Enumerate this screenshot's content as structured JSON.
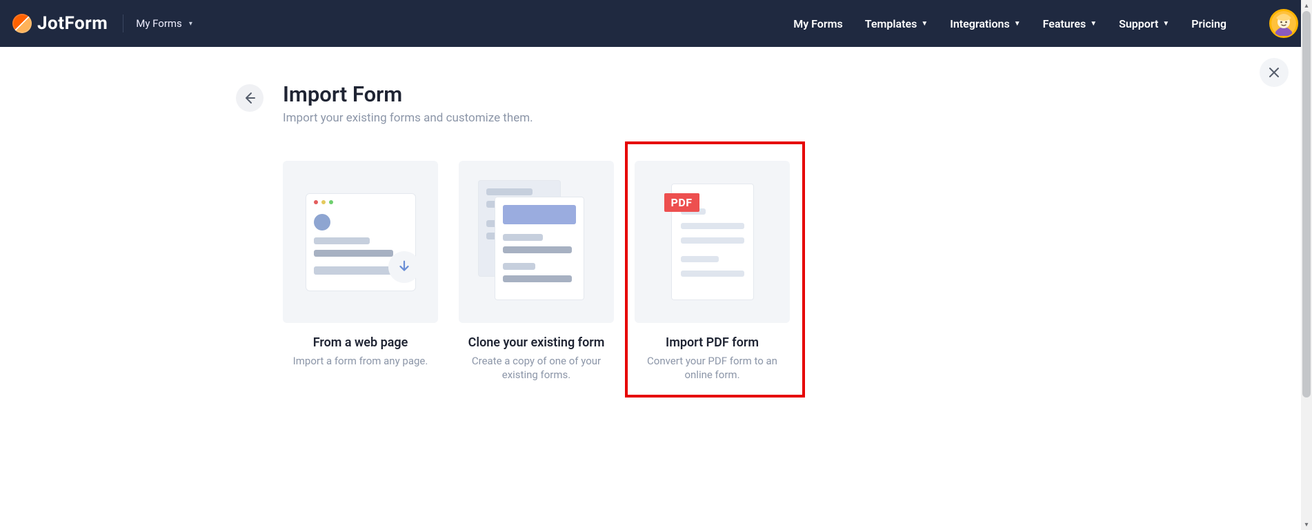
{
  "header": {
    "logo_text": "JotForm",
    "current_area": "My Forms",
    "nav": {
      "my_forms": "My Forms",
      "templates": "Templates",
      "integrations": "Integrations",
      "features": "Features",
      "support": "Support",
      "pricing": "Pricing"
    }
  },
  "page": {
    "title": "Import Form",
    "subtitle": "Import your existing forms and customize them."
  },
  "cards": [
    {
      "title": "From a web page",
      "desc": "Import a form from any page."
    },
    {
      "title": "Clone your existing form",
      "desc": "Create a copy of one of your existing forms."
    },
    {
      "title": "Import PDF form",
      "desc": "Convert your PDF form to an online form."
    }
  ],
  "highlight_index": 2,
  "colors": {
    "header_bg": "#1f2940",
    "highlight_border": "#e60000",
    "pdf_tag": "#ed4f4f"
  },
  "pdf_label": "PDF"
}
